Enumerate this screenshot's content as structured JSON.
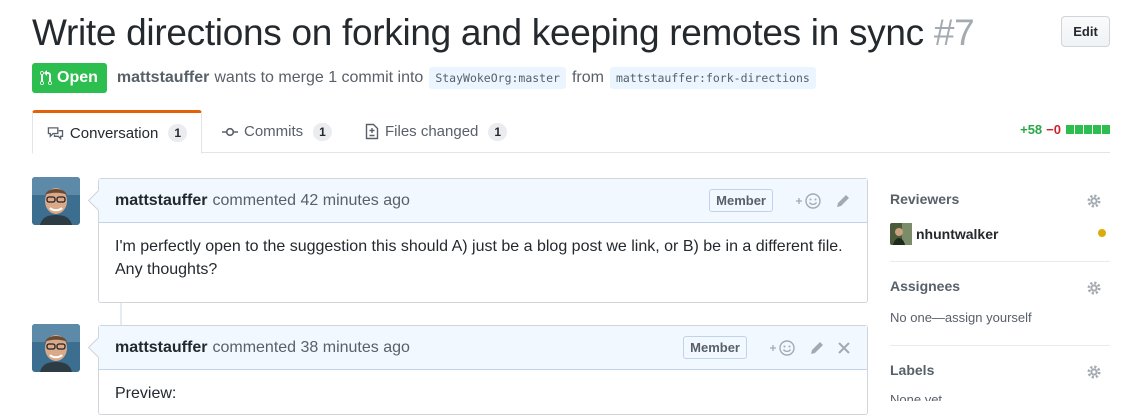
{
  "pr": {
    "title": "Write directions on forking and keeping remotes in sync",
    "number": "#7",
    "edit_label": "Edit",
    "state": "Open",
    "author": "mattstauffer",
    "merge_text": "wants to merge 1 commit into",
    "base_branch": "StayWokeOrg:master",
    "from_text": "from",
    "head_branch": "mattstauffer:fork-directions"
  },
  "tabs": [
    {
      "label": "Conversation",
      "count": "1",
      "icon": "comment-discussion-icon"
    },
    {
      "label": "Commits",
      "count": "1",
      "icon": "git-commit-icon"
    },
    {
      "label": "Files changed",
      "count": "1",
      "icon": "file-diff-icon"
    }
  ],
  "diffstat": {
    "additions": "+58",
    "deletions": "−0"
  },
  "comments": [
    {
      "author": "mattstauffer",
      "time": "commented 42 minutes ago",
      "badge": "Member",
      "body": "I'm perfectly open to the suggestion this should A) just be a blog post we link, or B) be in a different file. Any thoughts?"
    },
    {
      "author": "mattstauffer",
      "time": "commented 38 minutes ago",
      "badge": "Member",
      "body": "Preview:"
    }
  ],
  "sidebar": {
    "reviewers": {
      "title": "Reviewers",
      "user": "nhuntwalker"
    },
    "assignees": {
      "title": "Assignees",
      "text": "No one—assign yourself"
    },
    "labels": {
      "title": "Labels",
      "text": "None yet"
    }
  },
  "colors": {
    "open_green": "#2cbe4e",
    "add_green": "#28a745",
    "del_red": "#cb2431",
    "tab_accent": "#e36209",
    "comment_header": "#f1f8ff",
    "pending_dot": "#dbab09"
  }
}
